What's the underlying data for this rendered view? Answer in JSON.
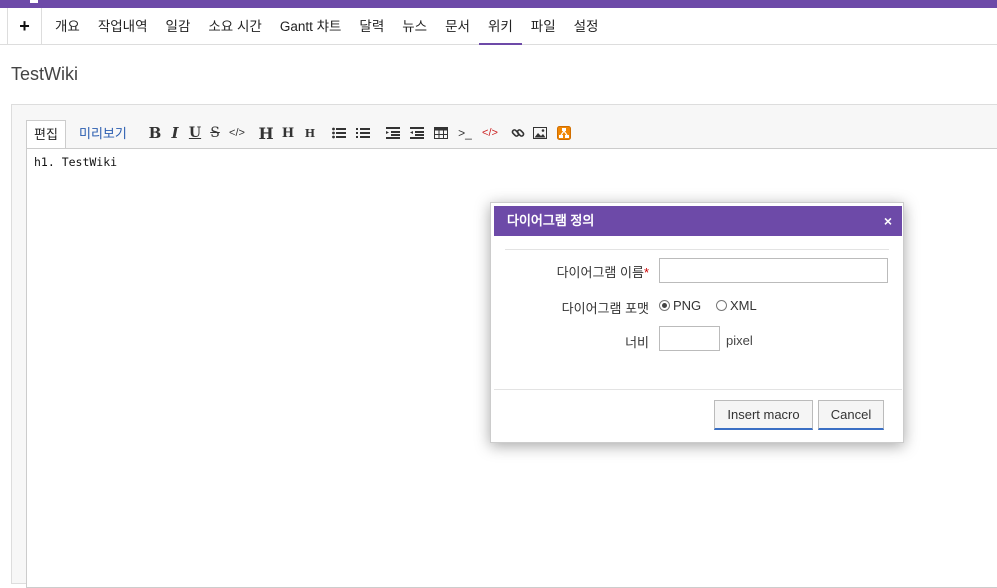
{
  "menu": {
    "plus_label": "+",
    "tabs": [
      {
        "label": "개요"
      },
      {
        "label": "작업내역"
      },
      {
        "label": "일감"
      },
      {
        "label": "소요 시간"
      },
      {
        "label": "Gantt 챠트"
      },
      {
        "label": "달력"
      },
      {
        "label": "뉴스"
      },
      {
        "label": "문서"
      },
      {
        "label": "위키",
        "active": true
      },
      {
        "label": "파일"
      },
      {
        "label": "설정"
      }
    ]
  },
  "page": {
    "title": "TestWiki"
  },
  "editor": {
    "mode_edit_label": "편집",
    "mode_preview_label": "미리보기",
    "toolbar_buttons": [
      "bold",
      "italic",
      "underline",
      "strikethrough",
      "code",
      "h1",
      "h2",
      "h3",
      "unordered-list",
      "ordered-list",
      "quote",
      "unquote",
      "table",
      "pre",
      "precode",
      "link",
      "image",
      "diagram"
    ],
    "content": "h1. TestWiki"
  },
  "dialog": {
    "title": "다이어그램 정의",
    "close_glyph": "×",
    "name_label": "다이어그램 이름",
    "name_required": "*",
    "name_value": "",
    "format_label": "다이어그램 포맷",
    "format_options": [
      "PNG",
      "XML"
    ],
    "format_selected": "PNG",
    "width_label": "너비",
    "width_value": "",
    "width_unit": "pixel",
    "insert_button": "Insert macro",
    "cancel_button": "Cancel"
  },
  "colors": {
    "accent": "#6d4aa8",
    "highlight": "#f5f200",
    "link": "#2a5db0",
    "required": "#cc0000"
  }
}
